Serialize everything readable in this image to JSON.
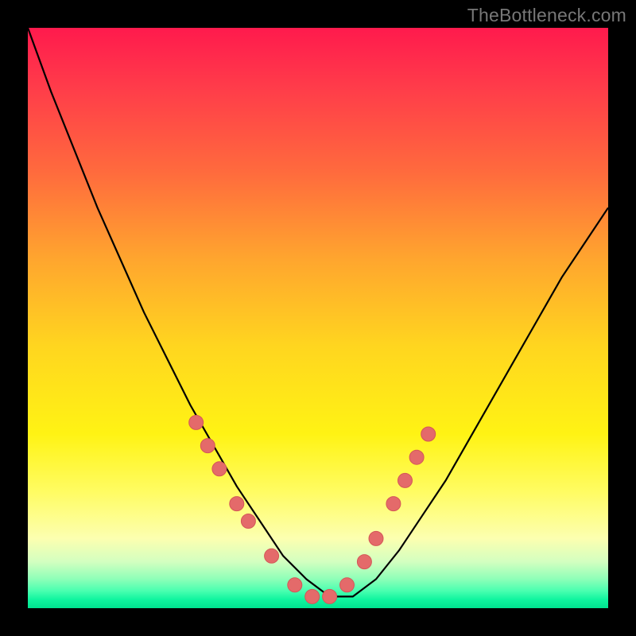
{
  "source_watermark": "TheBottleneck.com",
  "chart_data": {
    "type": "line",
    "title": "",
    "xlabel": "",
    "ylabel": "",
    "xlim": [
      0,
      100
    ],
    "ylim": [
      0,
      100
    ],
    "background": "rainbow-gradient vertical (red top → green bottom) on black frame",
    "series": [
      {
        "name": "bottleneck-curve",
        "x": [
          0,
          4,
          8,
          12,
          16,
          20,
          24,
          28,
          32,
          36,
          40,
          44,
          48,
          52,
          56,
          60,
          64,
          68,
          72,
          76,
          80,
          84,
          88,
          92,
          96,
          100
        ],
        "y": [
          100,
          89,
          79,
          69,
          60,
          51,
          43,
          35,
          28,
          21,
          15,
          9,
          5,
          2,
          2,
          5,
          10,
          16,
          22,
          29,
          36,
          43,
          50,
          57,
          63,
          69
        ]
      }
    ],
    "highlighted_points": {
      "name": "sample-markers",
      "x": [
        29,
        31,
        33,
        36,
        38,
        42,
        46,
        49,
        52,
        55,
        58,
        60,
        63,
        65,
        67,
        69
      ],
      "y": [
        32,
        28,
        24,
        18,
        15,
        9,
        4,
        2,
        2,
        4,
        8,
        12,
        18,
        22,
        26,
        30
      ]
    }
  }
}
